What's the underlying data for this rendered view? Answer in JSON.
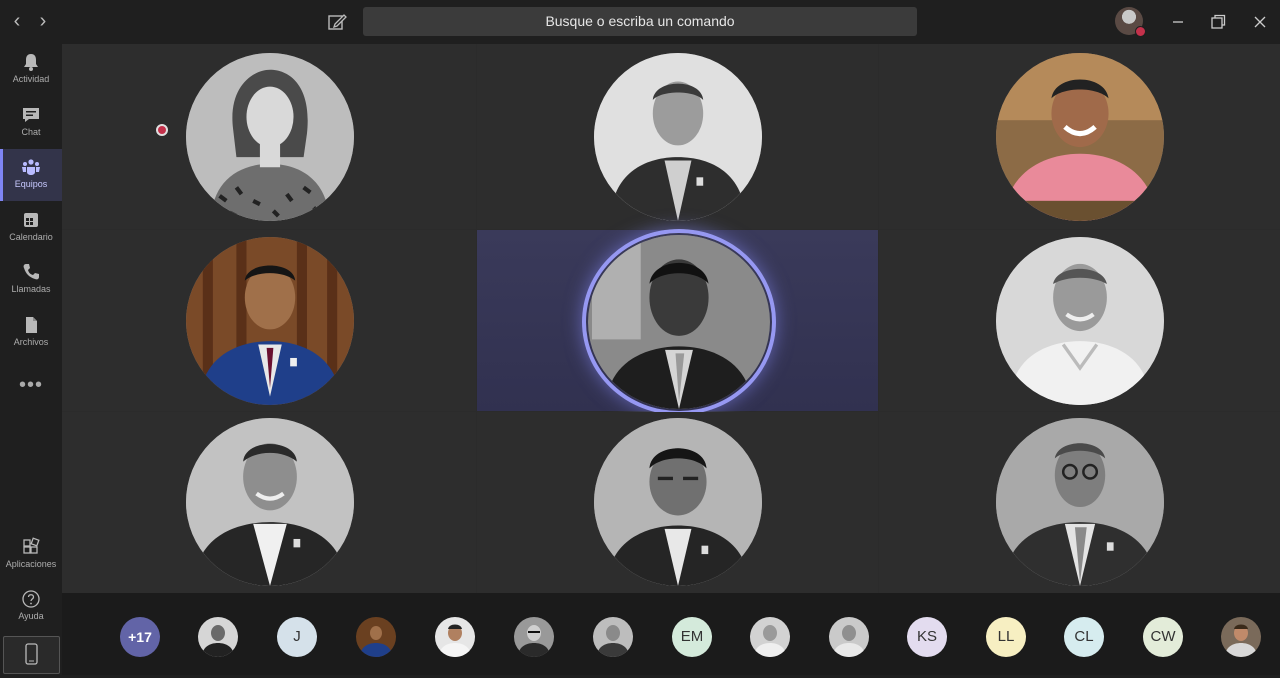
{
  "titlebar": {
    "search_placeholder": "Busque o escriba un comando",
    "back_arrow": "‹",
    "forward_arrow": "›",
    "icons": [
      "chevron-left-icon",
      "chevron-right-icon",
      "compose-icon",
      "minimize-icon",
      "restore-icon",
      "close-icon"
    ]
  },
  "rail": {
    "items": [
      {
        "label": "Actividad",
        "icon": "bell-icon"
      },
      {
        "label": "Chat",
        "icon": "chat-icon"
      },
      {
        "label": "Equipos",
        "icon": "teams-icon",
        "active": true
      },
      {
        "label": "Calendario",
        "icon": "calendar-icon"
      },
      {
        "label": "Llamadas",
        "icon": "phone-icon"
      },
      {
        "label": "Archivos",
        "icon": "files-icon"
      }
    ],
    "more_label": "•••",
    "bottom": [
      {
        "label": "Aplicaciones",
        "icon": "apps-icon"
      },
      {
        "label": "Ayuda",
        "icon": "help-icon"
      }
    ]
  },
  "meeting": {
    "recording": true,
    "speaking_tile_index": 4,
    "colors": {
      "accent": "#7f85f5",
      "recording": "#c4314b",
      "speaking_ring": "#9698f2"
    }
  },
  "roster": {
    "overflow_label": "+17",
    "chips": [
      {
        "type": "photo"
      },
      {
        "type": "initials",
        "text": "J",
        "bg": "#d5e1ea"
      },
      {
        "type": "photo"
      },
      {
        "type": "photo"
      },
      {
        "type": "photo"
      },
      {
        "type": "photo"
      },
      {
        "type": "initials",
        "text": "EM",
        "bg": "#d4eadb"
      },
      {
        "type": "photo"
      },
      {
        "type": "photo"
      },
      {
        "type": "initials",
        "text": "KS",
        "bg": "#e3dcef"
      },
      {
        "type": "initials",
        "text": "LL",
        "bg": "#f7efc2"
      },
      {
        "type": "initials",
        "text": "CL",
        "bg": "#d6ecef"
      },
      {
        "type": "initials",
        "text": "CW",
        "bg": "#e3ecd9"
      },
      {
        "type": "photo"
      }
    ]
  }
}
